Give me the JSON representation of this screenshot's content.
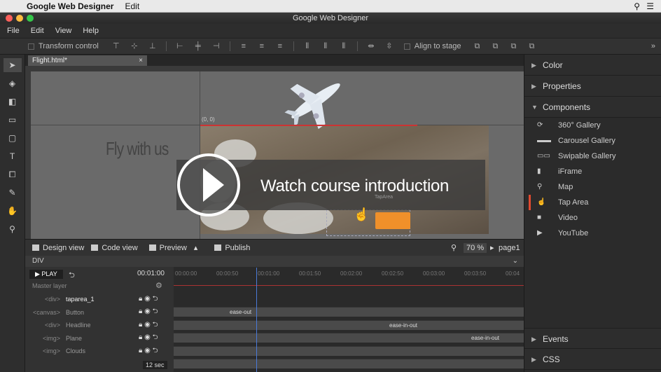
{
  "mac_menu": {
    "app": "Google Web Designer",
    "edit": "Edit"
  },
  "window_title": "Google Web Designer",
  "menu": [
    "File",
    "Edit",
    "View",
    "Help"
  ],
  "toolbar": {
    "transform_control": "Transform control",
    "align_to_stage": "Align to stage"
  },
  "doc_tab": {
    "name": "Flight.html*",
    "close": "×"
  },
  "stage": {
    "origin": "(0, 0)",
    "headline": "Fly with us",
    "tap_label": "TapArea"
  },
  "overlay": {
    "text": "Watch course introduction"
  },
  "stage_bar": {
    "design_view": "Design view",
    "code_view": "Code view",
    "preview": "Preview",
    "publish": "Publish",
    "zoom": "70",
    "zoom_unit": "%",
    "page": "page1"
  },
  "timeline": {
    "element": "DIV",
    "play": "PLAY",
    "time": "00:01:00",
    "master_layer": "Master layer",
    "duration": "12 sec",
    "ticks": [
      "00:00:00",
      "00:00:50",
      "00:01:00",
      "00:01:50",
      "00:02:00",
      "00:02:50",
      "00:03:00",
      "00:03:50",
      "00:04"
    ],
    "layers": [
      {
        "tag": "<div>",
        "name": "taparea_1"
      },
      {
        "tag": "<canvas>",
        "name": "Button"
      },
      {
        "tag": "<div>",
        "name": "Headline"
      },
      {
        "tag": "<img>",
        "name": "Plane"
      },
      {
        "tag": "<img>",
        "name": "Clouds"
      }
    ],
    "eases": [
      "ease-out",
      "ease-in-out",
      "ease-in-out"
    ]
  },
  "right_panel": {
    "sections": [
      "Color",
      "Properties",
      "Components",
      "Events",
      "CSS"
    ],
    "components": [
      "360° Gallery",
      "Carousel Gallery",
      "Swipable Gallery",
      "iFrame",
      "Map",
      "Tap Area",
      "Video",
      "YouTube"
    ],
    "selected_color": "#e04a30"
  }
}
